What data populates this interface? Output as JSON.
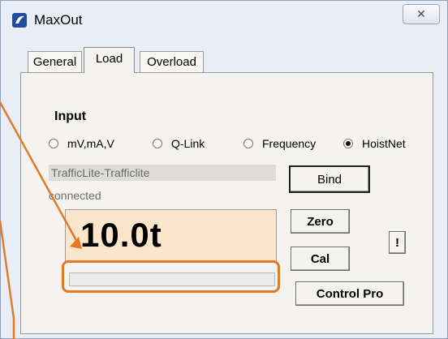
{
  "window": {
    "title": "MaxOut",
    "close_symbol": "✕"
  },
  "tabs": [
    {
      "label": "General"
    },
    {
      "label": "Load",
      "selected": true
    },
    {
      "label": "Overload"
    }
  ],
  "input": {
    "heading": "Input",
    "options": [
      {
        "label": "mV,mA,V",
        "selected": false
      },
      {
        "label": "Q-Link",
        "selected": false
      },
      {
        "label": "Frequency",
        "selected": false
      },
      {
        "label": "HoistNet",
        "selected": true
      }
    ]
  },
  "device": {
    "name": "TrafficLite-Trafficlite",
    "status": "connected"
  },
  "buttons": {
    "bind": "Bind",
    "zero": "Zero",
    "cal": "Cal",
    "bang": "!",
    "control_pro": "Control Pro"
  },
  "load": {
    "value": "10.0t",
    "progress": 0
  },
  "colors": {
    "display_bg": "#fbe6cc",
    "annotation": "#e07b2a"
  }
}
